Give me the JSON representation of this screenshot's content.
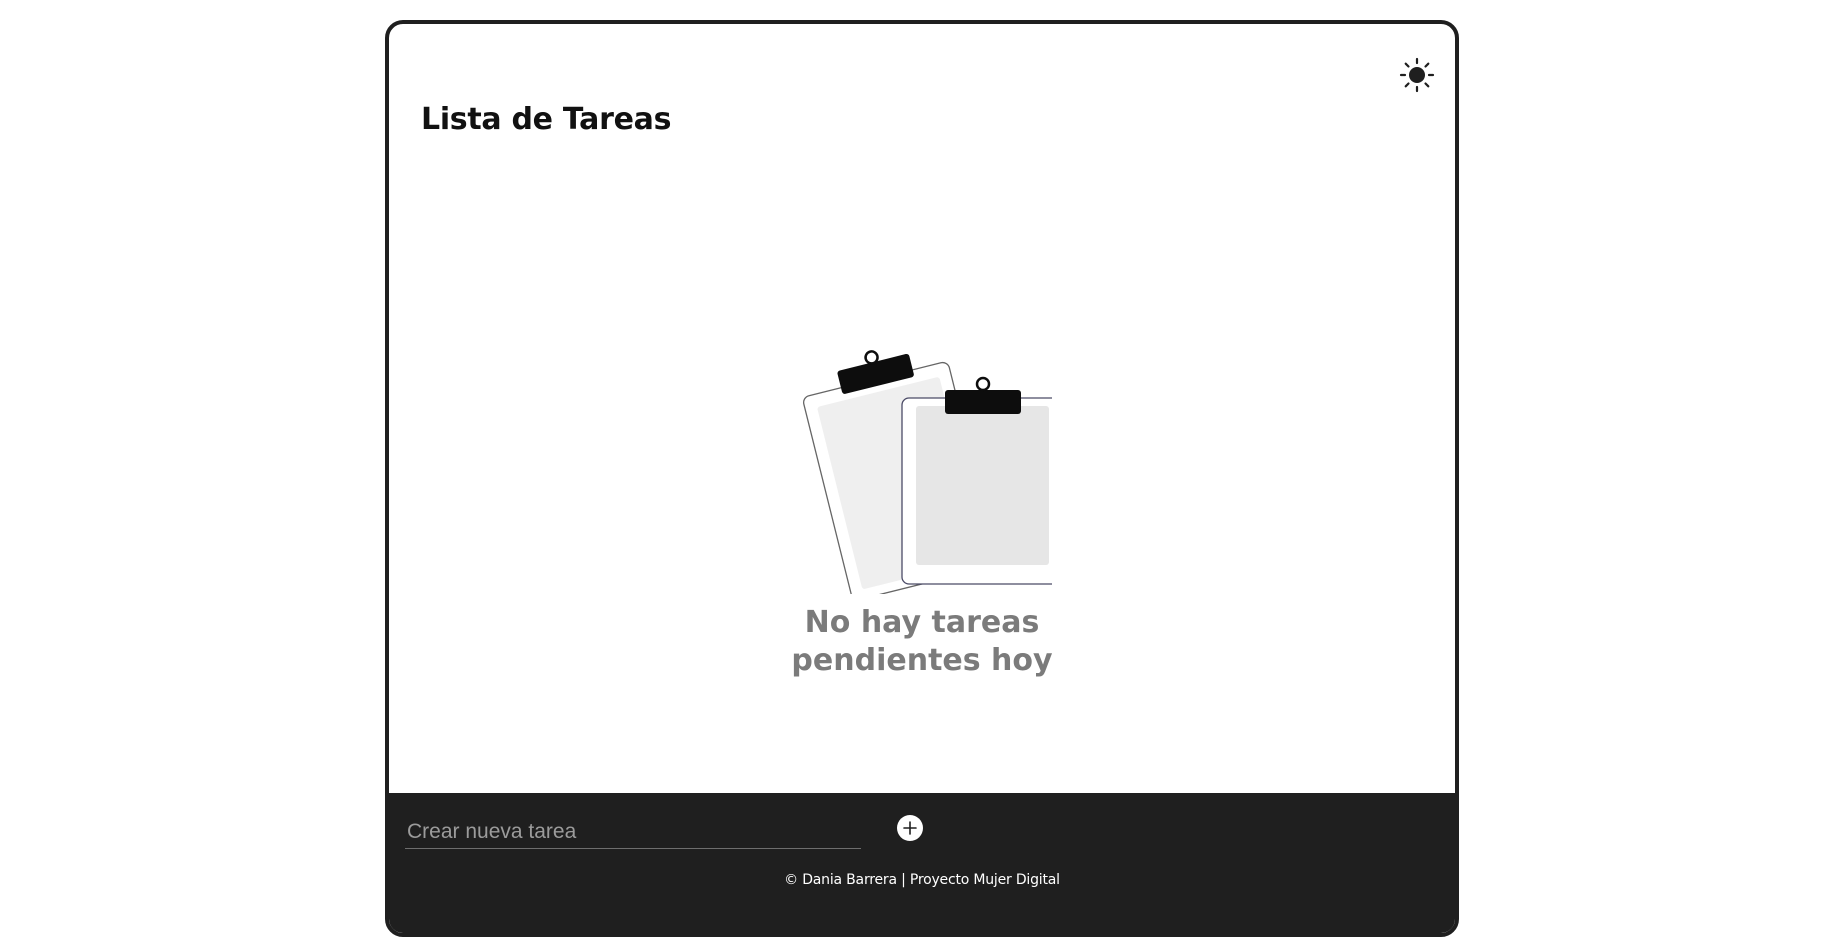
{
  "app": {
    "title": "Lista de Tareas"
  },
  "theme_toggle": {
    "icon": "sun-icon"
  },
  "empty_state": {
    "illustration": "clipboards-icon",
    "message": "No hay tareas pendientes hoy"
  },
  "new_task": {
    "placeholder": "Crear nueva tarea",
    "value": "",
    "add_icon": "plus-icon"
  },
  "footer": {
    "credit": "© Dania Barrera | Proyecto Mujer Digital"
  },
  "colors": {
    "frame_border": "#1f1f1f",
    "bottom_bar": "#1f1f1f",
    "empty_message": "#7b7b7b",
    "title": "#111111"
  }
}
